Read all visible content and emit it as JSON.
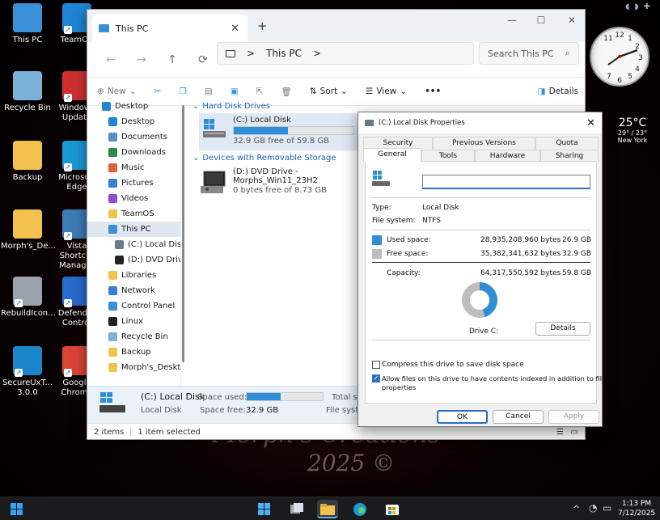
{
  "desktop": {
    "icons": [
      {
        "label": "This PC",
        "color": "#3a8fd6"
      },
      {
        "label": "TeamOS",
        "color": "#1e86d4"
      },
      {
        "label": "Recycle Bin",
        "color": "#7ab2d8"
      },
      {
        "label": "Windows Update",
        "color": "#d03030"
      },
      {
        "label": "Backup",
        "color": "#f2c14e"
      },
      {
        "label": "Microsoft Edge",
        "color": "#1a9bd7"
      },
      {
        "label": "Morph's_De...",
        "color": "#f2c14e"
      },
      {
        "label": "Vista Shortcut Manager",
        "color": "#3c7cb8"
      },
      {
        "label": "RebuildIcon...",
        "color": "#9aa3ad"
      },
      {
        "label": "Defender Control",
        "color": "#2a6bd0"
      },
      {
        "label": "SecureUxT... 3.0.0",
        "color": "#1b86c9"
      },
      {
        "label": "Google Chrome",
        "color": "#db4437"
      }
    ],
    "wallpaper_text": [
      "Morph's Creations",
      "2025 ©"
    ],
    "weather": {
      "temp": "25°C",
      "range": "29° / 23°",
      "city": "New York"
    },
    "clock": {
      "numbers": [
        "12",
        "1",
        "2",
        "3",
        "4",
        "5",
        "6",
        "7",
        "11"
      ]
    }
  },
  "explorer": {
    "tab_title": "This PC",
    "nav": {
      "back": "←",
      "forward": "→",
      "up": "↑",
      "refresh": "⟳"
    },
    "address": {
      "path": "This PC",
      "sep": ">"
    },
    "search": {
      "placeholder": "Search This PC"
    },
    "command_bar": {
      "new": "New",
      "sort": "Sort",
      "view": "View",
      "more": "•••",
      "details": "Details"
    },
    "sidebar": [
      {
        "label": "Desktop",
        "color": "#1e86d4",
        "sel": false,
        "kind": "top"
      },
      {
        "label": "Desktop",
        "color": "#1e86d4",
        "sel": false,
        "kind": "item"
      },
      {
        "label": "Documents",
        "color": "#5a8fc2",
        "sel": false,
        "kind": "item"
      },
      {
        "label": "Downloads",
        "color": "#2a8a4a",
        "sel": false,
        "kind": "item"
      },
      {
        "label": "Music",
        "color": "#e0603a",
        "sel": false,
        "kind": "item"
      },
      {
        "label": "Pictures",
        "color": "#3a7fd0",
        "sel": false,
        "kind": "item"
      },
      {
        "label": "Videos",
        "color": "#8a4fd0",
        "sel": false,
        "kind": "item"
      },
      {
        "label": "TeamOS",
        "color": "#f2c14e",
        "sel": false,
        "kind": "item"
      },
      {
        "label": "This PC",
        "color": "#3a8fd6",
        "sel": true,
        "kind": "item"
      },
      {
        "label": "(C:) Local Disk",
        "color": "#6a7a8a",
        "sel": false,
        "kind": "sub"
      },
      {
        "label": "(D:) DVD Drive",
        "color": "#222",
        "sel": false,
        "kind": "sub"
      },
      {
        "label": "Libraries",
        "color": "#f2c14e",
        "sel": false,
        "kind": "item"
      },
      {
        "label": "Network",
        "color": "#3a7fd0",
        "sel": false,
        "kind": "item"
      },
      {
        "label": "Control Panel",
        "color": "#3a8fd6",
        "sel": false,
        "kind": "item"
      },
      {
        "label": "Linux",
        "color": "#222",
        "sel": false,
        "kind": "item"
      },
      {
        "label": "Recycle Bin",
        "color": "#7ab2d8",
        "sel": false,
        "kind": "item"
      },
      {
        "label": "Backup",
        "color": "#f2c14e",
        "sel": false,
        "kind": "item"
      },
      {
        "label": "Morph's_Desktop",
        "color": "#f2c14e",
        "sel": false,
        "kind": "item"
      }
    ],
    "groups": {
      "hdd": "Hard Disk Drives",
      "removable": "Devices with Removable Storage"
    },
    "c_drive": {
      "name": "(C:) Local Disk",
      "free": "32.9 GB free of 59.8 GB",
      "used_fraction": 0.45
    },
    "d_drive": {
      "name": "(D:) DVD Drive -",
      "name2": "Morphs_Win11_23H2",
      "free": "0 bytes free of 8.73 GB"
    },
    "details_pane": {
      "name": "(C:) Local Disk",
      "type": "Local Disk",
      "space_used_label": "Space used:",
      "space_used_fraction": 0.45,
      "space_free_label": "Space free:",
      "space_free": "32.9 GB",
      "total_label": "Total siz",
      "fs_label": "File systen"
    },
    "status": {
      "items": "2 items",
      "selected": "1 item selected"
    }
  },
  "dialog": {
    "title": "(C:) Local Disk Properties",
    "tabs_row1": [
      "Security",
      "Previous Versions",
      "Quota"
    ],
    "tabs_row2": [
      "General",
      "Tools",
      "Hardware",
      "Sharing"
    ],
    "type_label": "Type:",
    "type": "Local Disk",
    "fs_label": "File system:",
    "fs": "NTFS",
    "used_label": "Used space:",
    "used_bytes": "28,935,208,960 bytes",
    "used_gb": "26.9 GB",
    "free_label": "Free space:",
    "free_bytes": "35,382,341,632 bytes",
    "free_gb": "32.9 GB",
    "cap_label": "Capacity:",
    "cap_bytes": "64,317,550,592 bytes",
    "cap_gb": "59.8 GB",
    "used_fraction": 0.45,
    "drive_label": "Drive C:",
    "details_btn": "Details",
    "compress": "Compress this drive to save disk space",
    "index_1": "Allow files on this drive to have contents indexed in addition to file",
    "index_2": "properties",
    "ok": "OK",
    "cancel": "Cancel",
    "apply": "Apply",
    "used_color": "#2f8ed6",
    "free_color": "#bdbdbd"
  },
  "taskbar": {
    "time": "1:13 PM",
    "date": "7/12/2025",
    "chevron": "^"
  }
}
